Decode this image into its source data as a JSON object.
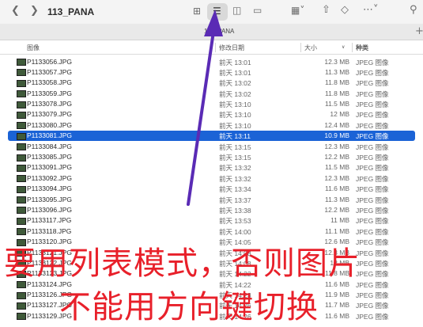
{
  "window": {
    "title": "113_PANA",
    "tab_label": "113_PANA"
  },
  "toolbar": {
    "back_icon": "chevron-left-icon",
    "forward_icon": "chevron-right-icon",
    "view_icons": [
      "grid-icon",
      "list-icon",
      "columns-icon",
      "gallery-icon"
    ],
    "plus": "+"
  },
  "columns": {
    "name": "图像",
    "date": "修改日期",
    "size": "大小",
    "kind": "种类"
  },
  "files": [
    {
      "name": "P1133056.JPG",
      "date": "前天 13:01",
      "size": "12.3 MB",
      "kind": "JPEG 图像"
    },
    {
      "name": "P1133057.JPG",
      "date": "前天 13:01",
      "size": "11.3 MB",
      "kind": "JPEG 图像"
    },
    {
      "name": "P1133058.JPG",
      "date": "前天 13:02",
      "size": "11.8 MB",
      "kind": "JPEG 图像"
    },
    {
      "name": "P1133059.JPG",
      "date": "前天 13:02",
      "size": "11.8 MB",
      "kind": "JPEG 图像"
    },
    {
      "name": "P1133078.JPG",
      "date": "前天 13:10",
      "size": "11.5 MB",
      "kind": "JPEG 图像"
    },
    {
      "name": "P1133079.JPG",
      "date": "前天 13:10",
      "size": "12 MB",
      "kind": "JPEG 图像"
    },
    {
      "name": "P1133080.JPG",
      "date": "前天 13:10",
      "size": "12.4 MB",
      "kind": "JPEG 图像"
    },
    {
      "name": "P1133081.JPG",
      "date": "前天 13:11",
      "size": "10.9 MB",
      "kind": "JPEG 图像",
      "selected": true
    },
    {
      "name": "P1133084.JPG",
      "date": "前天 13:15",
      "size": "12.3 MB",
      "kind": "JPEG 图像"
    },
    {
      "name": "P1133085.JPG",
      "date": "前天 13:15",
      "size": "12.2 MB",
      "kind": "JPEG 图像"
    },
    {
      "name": "P1133091.JPG",
      "date": "前天 13:32",
      "size": "11.5 MB",
      "kind": "JPEG 图像"
    },
    {
      "name": "P1133092.JPG",
      "date": "前天 13:32",
      "size": "12.3 MB",
      "kind": "JPEG 图像"
    },
    {
      "name": "P1133094.JPG",
      "date": "前天 13:34",
      "size": "11.6 MB",
      "kind": "JPEG 图像"
    },
    {
      "name": "P1133095.JPG",
      "date": "前天 13:37",
      "size": "11.3 MB",
      "kind": "JPEG 图像"
    },
    {
      "name": "P1133096.JPG",
      "date": "前天 13:38",
      "size": "12.2 MB",
      "kind": "JPEG 图像"
    },
    {
      "name": "P1133117.JPG",
      "date": "前天 13:53",
      "size": "11 MB",
      "kind": "JPEG 图像"
    },
    {
      "name": "P1133118.JPG",
      "date": "前天 14:00",
      "size": "11.1 MB",
      "kind": "JPEG 图像"
    },
    {
      "name": "P1133120.JPG",
      "date": "前天 14:05",
      "size": "12.6 MB",
      "kind": "JPEG 图像"
    },
    {
      "name": "P1133121.JPG",
      "date": "前天 14:08",
      "size": "12.3 MB",
      "kind": "JPEG 图像"
    },
    {
      "name": "P1133122.JPG",
      "date": "前天 14:08",
      "size": "12 MB",
      "kind": "JPEG 图像"
    },
    {
      "name": "P1133123.JPG",
      "date": "前天 14:22",
      "size": "11.8 MB",
      "kind": "JPEG 图像"
    },
    {
      "name": "P1133124.JPG",
      "date": "前天 14:22",
      "size": "11.6 MB",
      "kind": "JPEG 图像"
    },
    {
      "name": "P1133126.JPG",
      "date": "前天 14:23",
      "size": "11.9 MB",
      "kind": "JPEG 图像"
    },
    {
      "name": "P1133127.JPG",
      "date": "前天 14:26",
      "size": "11.7 MB",
      "kind": "JPEG 图像"
    },
    {
      "name": "P1133129.JPG",
      "date": "前天 14:26",
      "size": "11.6 MB",
      "kind": "JPEG 图像"
    }
  ],
  "annotation": {
    "line1": "要用列表模式，否则图片",
    "line2": "不能用方向键切换",
    "arrow_color": "#5a2bb5",
    "text_color": "#e8202a"
  }
}
